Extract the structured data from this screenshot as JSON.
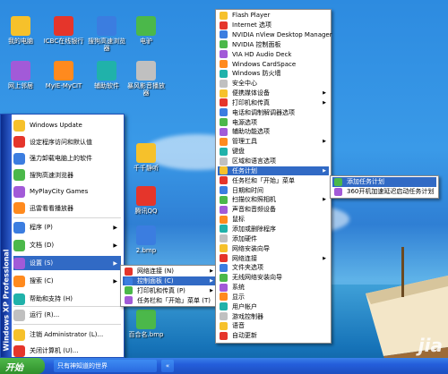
{
  "colors": {
    "selection": "#316ac5",
    "taskbar": "#245edb",
    "start_green": "#2f8f2b"
  },
  "desktop_icons": [
    {
      "label": "我的电脑",
      "icon": "computer-icon"
    },
    {
      "label": "ICBC在线银行",
      "icon": "bank-icon"
    },
    {
      "label": "搜狗高速浏览器",
      "icon": "sogou-browser-icon"
    },
    {
      "label": "电驴",
      "icon": "emule-icon"
    },
    {
      "label": "网上邻居",
      "icon": "network-icon"
    },
    {
      "label": "MyIE-MyCIT",
      "icon": "myie-icon"
    },
    {
      "label": "辅助软件",
      "icon": "folder-icon"
    },
    {
      "label": "暴风影音播放器",
      "icon": "storm-player-icon"
    },
    {
      "label": "千千静听",
      "icon": "ttplayer-icon"
    },
    {
      "label": "腾讯QQ",
      "icon": "qq-icon"
    },
    {
      "label": "2.bmp",
      "icon": "bitmap-icon"
    },
    {
      "label": "百合名.bmp",
      "icon": "bitmap-icon"
    }
  ],
  "start_menu": {
    "band_text": "Windows XP Professional",
    "top_items": [
      {
        "label": "Windows Update",
        "icon": "windows-update-icon"
      },
      {
        "label": "设定程序访问和默认值",
        "icon": "program-access-icon"
      },
      {
        "label": "强力卸载电脑上的软件",
        "icon": "uninstall-icon"
      },
      {
        "label": "搜狗高速浏览器",
        "icon": "sogou-browser-icon"
      },
      {
        "label": "MyPlayCity Games",
        "icon": "games-icon"
      },
      {
        "label": "迅雷看看播放器",
        "icon": "xunlei-icon"
      }
    ],
    "bottom_items": [
      {
        "label": "程序 (P)",
        "icon": "programs-icon",
        "arrow": true
      },
      {
        "label": "文档 (D)",
        "icon": "documents-icon",
        "arrow": true
      },
      {
        "label": "设置 (S)",
        "icon": "settings-icon",
        "arrow": true,
        "selected": true
      },
      {
        "label": "搜索 (C)",
        "icon": "search-icon",
        "arrow": true
      },
      {
        "label": "帮助和支持 (H)",
        "icon": "help-icon"
      },
      {
        "label": "运行 (R)...",
        "icon": "run-icon"
      },
      {
        "label": "注销 Administrator (L)...",
        "icon": "logoff-icon"
      },
      {
        "label": "关闭计算机 (U)...",
        "icon": "shutdown-icon"
      }
    ]
  },
  "settings_menu": [
    {
      "label": "网络连接 (N)",
      "icon": "network-connections-icon",
      "arrow": true
    },
    {
      "label": "控制面板 (C)",
      "icon": "control-panel-icon",
      "arrow": true,
      "selected": true
    },
    {
      "label": "打印机和传真 (P)",
      "icon": "printer-icon",
      "arrow": true
    },
    {
      "label": "任务栏和「开始」菜单 (T)",
      "icon": "taskbar-icon"
    }
  ],
  "control_panel": [
    {
      "label": "Flash Player",
      "icon": "flash-icon"
    },
    {
      "label": "Internet 选项",
      "icon": "internet-options-icon"
    },
    {
      "label": "NVIDIA nView Desktop Manager",
      "icon": "nvidia-icon"
    },
    {
      "label": "NVIDIA 控制面板",
      "icon": "nvidia-icon"
    },
    {
      "label": "VIA HD Audio Deck",
      "icon": "audio-icon"
    },
    {
      "label": "Windows CardSpace",
      "icon": "cardspace-icon"
    },
    {
      "label": "Windows 防火墙",
      "icon": "firewall-icon"
    },
    {
      "label": "安全中心",
      "icon": "security-center-icon"
    },
    {
      "label": "便携媒体设备",
      "icon": "media-device-icon",
      "arrow": true
    },
    {
      "label": "打印机和传真",
      "icon": "printer-icon",
      "arrow": true
    },
    {
      "label": "电话和调制解调器选项",
      "icon": "phone-icon"
    },
    {
      "label": "电源选项",
      "icon": "power-icon"
    },
    {
      "label": "辅助功能选项",
      "icon": "accessibility-icon"
    },
    {
      "label": "管理工具",
      "icon": "admin-tools-icon",
      "arrow": true
    },
    {
      "label": "键盘",
      "icon": "keyboard-icon"
    },
    {
      "label": "区域和语言选项",
      "icon": "region-icon"
    },
    {
      "label": "任务计划",
      "icon": "scheduled-tasks-icon",
      "arrow": true,
      "selected": true
    },
    {
      "label": "任务栏和「开始」菜单",
      "icon": "taskbar-icon"
    },
    {
      "label": "日期和时间",
      "icon": "clock-icon"
    },
    {
      "label": "扫描仪和照相机",
      "icon": "scanner-icon",
      "arrow": true
    },
    {
      "label": "声音和音频设备",
      "icon": "sound-icon"
    },
    {
      "label": "鼠标",
      "icon": "mouse-icon"
    },
    {
      "label": "添加或删除程序",
      "icon": "add-remove-icon"
    },
    {
      "label": "添加硬件",
      "icon": "add-hardware-icon"
    },
    {
      "label": "网络安装向导",
      "icon": "network-wizard-icon"
    },
    {
      "label": "网络连接",
      "icon": "network-connections-icon",
      "arrow": true
    },
    {
      "label": "文件夹选项",
      "icon": "folder-options-icon"
    },
    {
      "label": "无线网络安装向导",
      "icon": "wireless-icon"
    },
    {
      "label": "系统",
      "icon": "system-icon"
    },
    {
      "label": "显示",
      "icon": "display-icon"
    },
    {
      "label": "用户帐户",
      "icon": "user-accounts-icon"
    },
    {
      "label": "游戏控制器",
      "icon": "gamepad-icon"
    },
    {
      "label": "语音",
      "icon": "speech-icon"
    },
    {
      "label": "自动更新",
      "icon": "auto-update-icon"
    }
  ],
  "task_menu": [
    {
      "label": "添加任务计划",
      "icon": "add-task-icon",
      "selected": true
    },
    {
      "label": "360开机加速延迟启动任务计划",
      "icon": "task-360-icon"
    }
  ],
  "taskbar": {
    "start_label": "开始",
    "window_label": "只有神知道的世界"
  },
  "watermark": "jia"
}
